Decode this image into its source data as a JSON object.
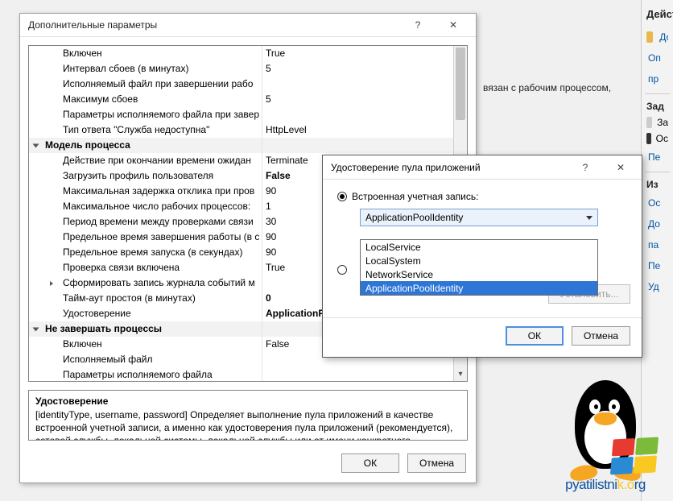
{
  "bg": {
    "body_text": "вязан с рабочим процессом,",
    "right_title": "Дейст",
    "items": [
      {
        "type": "link",
        "text": "До",
        "icon": "#e8b84a"
      },
      {
        "type": "link",
        "text": "Оп"
      },
      {
        "type": "link",
        "text": "пр"
      },
      {
        "type": "sep"
      },
      {
        "type": "bold",
        "text": "Зад"
      },
      {
        "type": "row",
        "text": "За",
        "icon": "#ccc"
      },
      {
        "type": "row",
        "text": "Ос",
        "icon": "#333"
      },
      {
        "type": "link",
        "text": "Пе"
      },
      {
        "type": "sep"
      },
      {
        "type": "bold",
        "text": "Из"
      },
      {
        "type": "link",
        "text": "Ос"
      },
      {
        "type": "link",
        "text": "До"
      },
      {
        "type": "link",
        "text": "па"
      },
      {
        "type": "link",
        "text": "Пе"
      },
      {
        "type": "link",
        "text": "Уд"
      }
    ]
  },
  "dlg1": {
    "title": "Дополнительные параметры",
    "help_glyph": "?",
    "close_glyph": "✕",
    "rows": [
      {
        "type": "prop",
        "label": "Включен",
        "value": "True"
      },
      {
        "type": "prop",
        "label": "Интервал сбоев (в минутах)",
        "value": "5"
      },
      {
        "type": "prop",
        "label": "Исполняемый файл при завершении рабо",
        "value": ""
      },
      {
        "type": "prop",
        "label": "Максимум сбоев",
        "value": "5"
      },
      {
        "type": "prop",
        "label": "Параметры исполняемого файла при завер",
        "value": ""
      },
      {
        "type": "prop",
        "label": "Тип ответа \"Служба недоступна\"",
        "value": "HttpLevel"
      },
      {
        "type": "cat",
        "label": "Модель процесса"
      },
      {
        "type": "prop",
        "label": "Действие при окончании времени ожидан",
        "value": "Terminate"
      },
      {
        "type": "prop",
        "label": "Загрузить профиль пользователя",
        "value": "False",
        "bold": true
      },
      {
        "type": "prop",
        "label": "Максимальная задержка отклика при пров",
        "value": "90"
      },
      {
        "type": "prop",
        "label": "Максимальное число рабочих процессов:",
        "value": "1"
      },
      {
        "type": "prop",
        "label": "Период времени между проверками связи",
        "value": "30"
      },
      {
        "type": "prop",
        "label": "Предельное время завершения работы (в с",
        "value": "90"
      },
      {
        "type": "prop",
        "label": "Предельное время запуска (в секундах)",
        "value": "90"
      },
      {
        "type": "prop",
        "label": "Проверка связи включена",
        "value": "True"
      },
      {
        "type": "prop",
        "label": "Сформировать запись журнала событий м",
        "value": "",
        "expand": true
      },
      {
        "type": "prop",
        "label": "Тайм-аут простоя (в минутах)",
        "value": "0",
        "bold": true
      },
      {
        "type": "prop",
        "label": "Удостоверение",
        "value": "ApplicationPool",
        "bold": true
      },
      {
        "type": "cat",
        "label": "Не завершать процессы"
      },
      {
        "type": "prop",
        "label": "Включен",
        "value": "False"
      },
      {
        "type": "prop",
        "label": "Исполняемый файл",
        "value": ""
      },
      {
        "type": "prop",
        "label": "Параметры исполняемого файла",
        "value": ""
      }
    ],
    "desc_title": "Удостоверение",
    "desc_body": "[identityType, username, password] Определяет выполнение пула приложений в качестве встроенной учетной записи, а именно как удостоверения пула приложений (рекомендуется), сетевой службы, локальной системы, локальной службы или от имени конкретного пользова...",
    "ok": "ОК",
    "cancel": "Отмена"
  },
  "dlg2": {
    "title": "Удостоверение пула приложений",
    "help_glyph": "?",
    "close_glyph": "✕",
    "radio1_label": "Встроенная учетная запись:",
    "combo_value": "ApplicationPoolIdentity",
    "dropdown": [
      "LocalService",
      "LocalSystem",
      "NetworkService",
      "ApplicationPoolIdentity"
    ],
    "selected_index": 3,
    "set_button": "Установить...",
    "ok": "ОК",
    "cancel": "Отмена"
  },
  "logo": {
    "text_a": "pyatilistni",
    "text_b": "k.o",
    "text_c": "rg"
  }
}
